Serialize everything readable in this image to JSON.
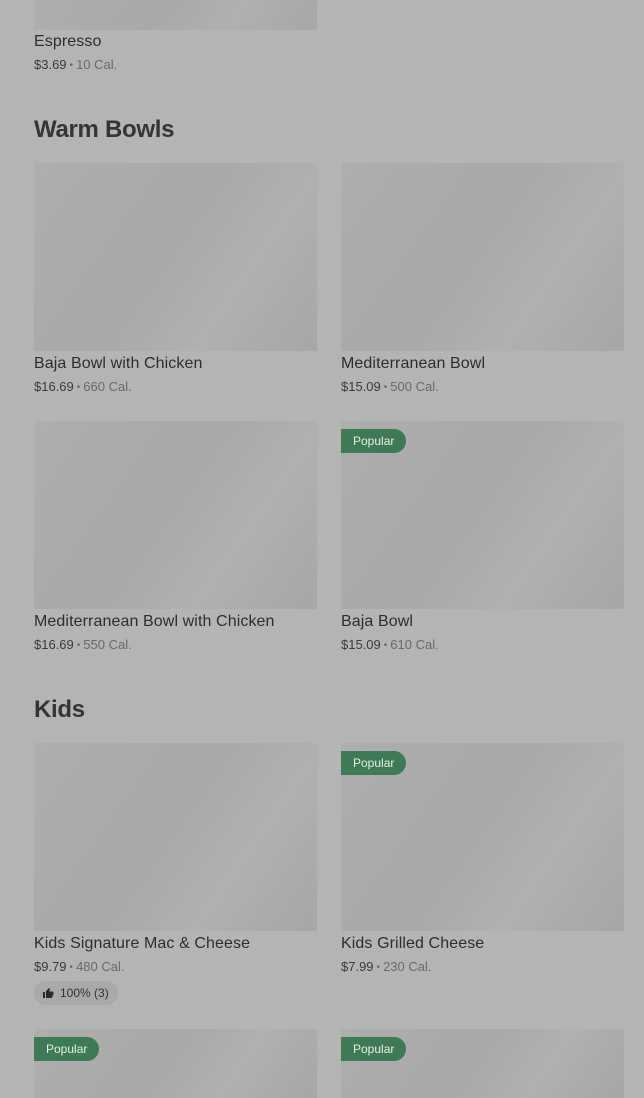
{
  "sections": [
    {
      "title": "",
      "items": [
        {
          "name": "Espresso",
          "price": "$3.69",
          "calories": "10 Cal."
        }
      ]
    },
    {
      "title": "Warm Bowls",
      "items": [
        {
          "name": "Baja Bowl with Chicken",
          "price": "$16.69",
          "calories": "660 Cal."
        },
        {
          "name": "Mediterranean Bowl",
          "price": "$15.09",
          "calories": "500 Cal."
        },
        {
          "name": "Mediterranean Bowl with Chicken",
          "price": "$16.69",
          "calories": "550 Cal."
        },
        {
          "name": "Baja Bowl",
          "price": "$15.09",
          "calories": "610 Cal.",
          "badge": "Popular"
        }
      ]
    },
    {
      "title": "Kids",
      "items": [
        {
          "name": "Kids Signature Mac & Cheese",
          "price": "$9.79",
          "calories": "480 Cal.",
          "rating": "100% (3)"
        },
        {
          "name": "Kids Grilled Cheese",
          "price": "$7.99",
          "calories": "230 Cal.",
          "badge": "Popular"
        },
        {
          "badge": "Popular"
        },
        {
          "badge": "Popular"
        }
      ]
    }
  ],
  "separator": "•",
  "icons": {
    "rating": "thumbs-up-icon"
  },
  "colors": {
    "badge_bg": "#3e7a55",
    "page_bg": "#b4b4b4"
  }
}
